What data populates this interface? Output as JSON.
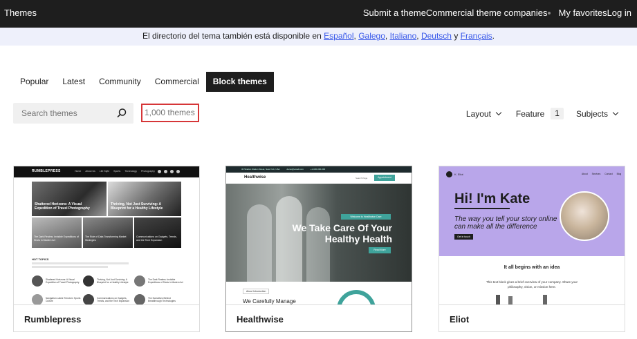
{
  "topbar": {
    "title": "Themes",
    "nav": [
      "Submit a theme",
      "Commercial theme companies",
      "My favorites",
      "Log in"
    ]
  },
  "notice": {
    "text": "El directorio del tema también está disponible en",
    "langs": [
      "Español",
      "Galego",
      "Italiano",
      "Deutsch",
      "Français"
    ],
    "and": "y"
  },
  "tabs": [
    "Popular",
    "Latest",
    "Community",
    "Commercial",
    "Block themes"
  ],
  "search": {
    "placeholder": "Search themes"
  },
  "count": "1,000 themes",
  "filters": {
    "layout": "Layout",
    "feature": "Feature",
    "feature_count": "1",
    "subjects": "Subjects"
  },
  "cards": [
    {
      "name": "Rumblepress",
      "preview": {
        "logo": "RUMBLEPRESS",
        "menu": [
          "Home",
          "About Us",
          "Life Style",
          "Sports",
          "Technology",
          "Photography"
        ],
        "headlines": [
          "Shattered Horizons: A Visual Expedition of Travel Photography",
          "Thriving, Not Just Surviving: A Blueprint for a Healthy Lifestyle",
          "The Dark Realms: Invisible Expeditions of Shots in Modern Art",
          "The Role of Data Transforming Market Strategies",
          "Communications on Gadgets, Trends, and the Tech Expansion"
        ],
        "section": "HOT TOPICS",
        "list": [
          "Shattered Horizons: A Visual Expedition of Travel Photography",
          "Thriving, Not Just Surviving: A Blueprint for a Healthy Lifestyle",
          "The Dark Realms: Invisible Expeditions of Shots in Modern Art",
          "Navigation Latest Trends in Sports Culture",
          "Communications on Gadgets, Trends, and the Tech Expansion",
          "The Narratives Behind Breakthrough Technologies"
        ]
      }
    },
    {
      "name": "Healthwise",
      "preview": {
        "contact": [
          "36 Shelton Station Street, New York, USA",
          "demo@email.com",
          "+1-020-000-000"
        ],
        "logo": "Healthwise",
        "search_label": "Search Page",
        "cta": "Appointment",
        "kicker": "Welcome to Healthwise Care",
        "hero": "We Take Care Of Your Healthy Health",
        "button": "Read More",
        "section_kicker": "About Introduction",
        "section_title": "We Carefully Manage"
      }
    },
    {
      "name": "Eliot",
      "preview": {
        "logo": "K. Eliot",
        "menu": [
          "About",
          "Services",
          "Contact",
          "Blog"
        ],
        "hero": "Hi! I'm Kate",
        "tagline": "The way you tell your story online can make all the difference",
        "button": "Get in touch",
        "section_title": "It all begins with an idea",
        "body": "This text block gives a brief overview of your company. Share your philosophy, vision, or mission here."
      }
    }
  ],
  "colors": {
    "accent": "#3858e9",
    "highlight": "#d63638",
    "dark": "#1e1e1e",
    "eliot_purple": "#b9a6ea",
    "health_teal": "#3fa39b"
  },
  "icons": {
    "search": "search-icon"
  }
}
